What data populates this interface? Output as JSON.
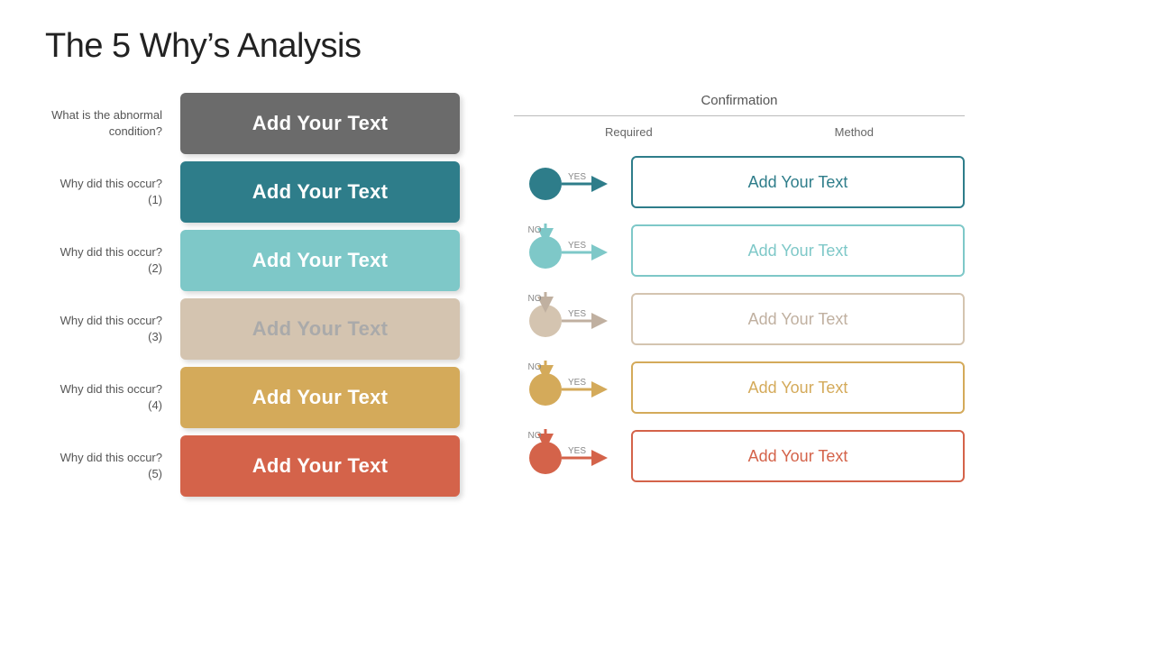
{
  "page": {
    "title": "The 5 Why’s Analysis"
  },
  "left": {
    "rows": [
      {
        "label": "What is the abnormal condition?",
        "box_text": "Add Your Text",
        "box_class": "box-gray",
        "name": "abnormal-condition"
      },
      {
        "label": "Why did this occur? (1)",
        "box_text": "Add Your Text",
        "box_class": "box-teal",
        "name": "why-1"
      },
      {
        "label": "Why did this occur? (2)",
        "box_text": "Add Your Text",
        "box_class": "box-light-teal",
        "name": "why-2"
      },
      {
        "label": "Why did this occur? (3)",
        "box_text": "Add Your Text",
        "box_class": "box-beige",
        "name": "why-3"
      },
      {
        "label": "Why did this occur? (4)",
        "box_text": "Add Your Text",
        "box_class": "box-yellow",
        "name": "why-4"
      },
      {
        "label": "Why did this occur? (5)",
        "box_text": "Add Your Text",
        "box_class": "box-orange",
        "name": "why-5"
      }
    ]
  },
  "right": {
    "header": "Confirmation",
    "subheader_left": "Required",
    "subheader_right": "Method",
    "rows": [
      {
        "circle_color": "#2e7d8a",
        "arrow_color": "#2e7d8a",
        "down_arrow_color": "#2e7d8a",
        "conf_class": "conf-box-teal",
        "conf_text": "Add Your Text",
        "name": "conf-1",
        "show_no": false
      },
      {
        "circle_color": "#7ec8c8",
        "arrow_color": "#7ec8c8",
        "down_arrow_color": "#7ec8c8",
        "conf_class": "conf-box-light-teal",
        "conf_text": "Add Your Text",
        "name": "conf-2",
        "show_no": true
      },
      {
        "circle_color": "#d4c4b0",
        "arrow_color": "#c0b0a0",
        "down_arrow_color": "#c0b0a0",
        "conf_class": "conf-box-beige",
        "conf_text": "Add Your Text",
        "name": "conf-3",
        "show_no": true
      },
      {
        "circle_color": "#d4aa5a",
        "arrow_color": "#d4aa5a",
        "down_arrow_color": "#d4aa5a",
        "conf_class": "conf-box-yellow",
        "conf_text": "Add Your Text",
        "name": "conf-4",
        "show_no": true
      },
      {
        "circle_color": "#d4634a",
        "arrow_color": "#d4634a",
        "down_arrow_color": "#d4634a",
        "conf_class": "conf-box-orange",
        "conf_text": "Add Your Text",
        "name": "conf-5",
        "show_no": true
      }
    ]
  }
}
